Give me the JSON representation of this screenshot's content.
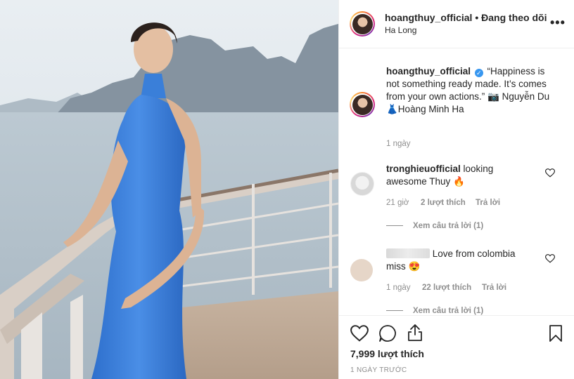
{
  "header": {
    "username": "hoangthuy_official",
    "separator": "•",
    "follow_status": "Đang theo dõi",
    "location": "Ha Long",
    "more_icon": "more-dots-icon"
  },
  "caption": {
    "username": "hoangthuy_official",
    "text_line": "“Happiness is not something ready made. It’s comes from your own actions.” 📷 Nguyễn Du",
    "credit": "👗Hoàng Minh Ha",
    "time": "1 ngày"
  },
  "comments": [
    {
      "username": "tronghieuofficial",
      "text": "looking awesome Thuy 🔥",
      "time": "21 giờ",
      "likes": "2 lượt thích",
      "reply": "Trả lời",
      "view_replies": "Xem câu trả lời (1)"
    },
    {
      "username": "",
      "text": "Love from colombia miss 😍",
      "time": "1 ngày",
      "likes": "22 lượt thích",
      "reply": "Trả lời",
      "view_replies": "Xem câu trả lời (1)"
    }
  ],
  "actions": {
    "like_icon": "heart-icon",
    "comment_icon": "comment-icon",
    "share_icon": "share-icon",
    "save_icon": "bookmark-icon",
    "likes_count": "7,999 lượt thích",
    "posted_ago": "1 NGÀY TRƯỚC"
  },
  "colors": {
    "dress": "#3a7fd9",
    "verified": "#3897f0",
    "text": "#262626",
    "muted": "#8e8e8e"
  }
}
